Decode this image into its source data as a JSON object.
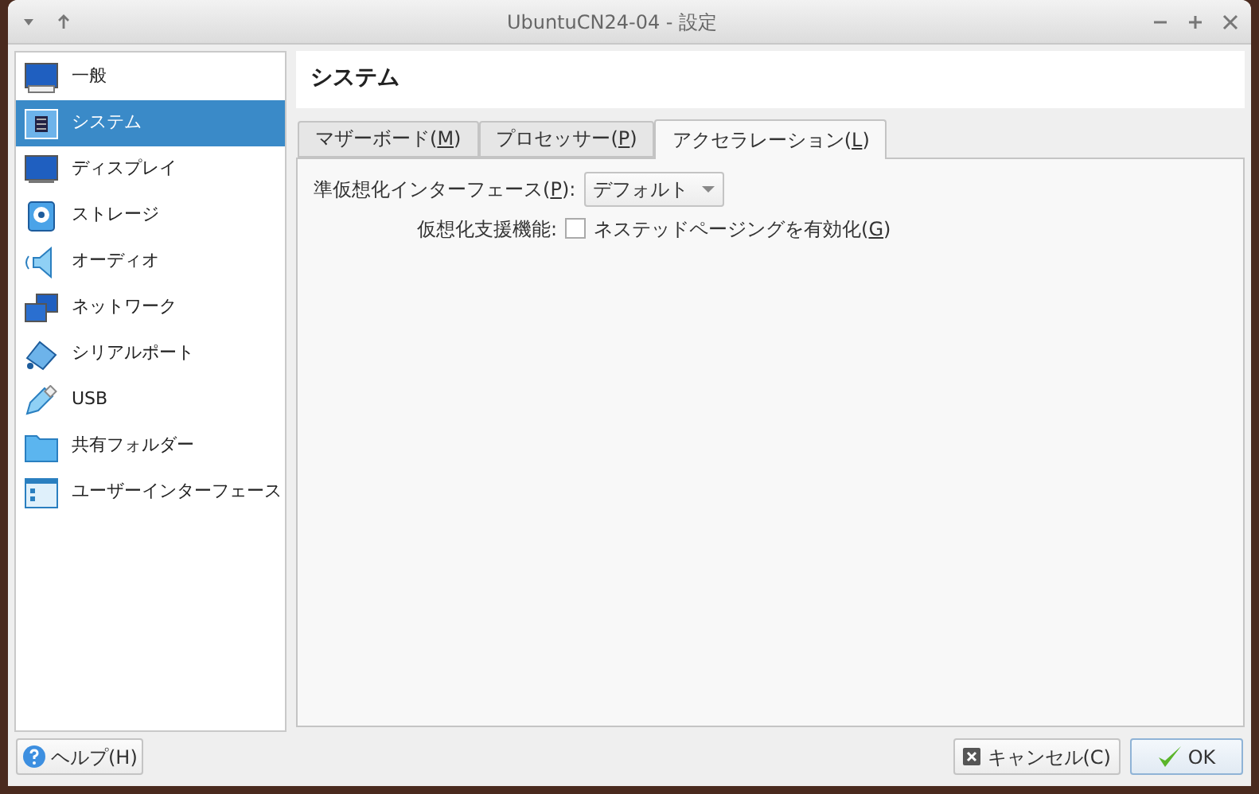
{
  "window": {
    "title": "UbuntuCN24-04 - 設定"
  },
  "sidebar": {
    "items": [
      {
        "label": "一般",
        "kind": "monitor",
        "selected": false
      },
      {
        "label": "システム",
        "kind": "chip",
        "selected": true
      },
      {
        "label": "ディスプレイ",
        "kind": "display",
        "selected": false
      },
      {
        "label": "ストレージ",
        "kind": "disk",
        "selected": false
      },
      {
        "label": "オーディオ",
        "kind": "speaker",
        "selected": false
      },
      {
        "label": "ネットワーク",
        "kind": "network",
        "selected": false
      },
      {
        "label": "シリアルポート",
        "kind": "serial",
        "selected": false
      },
      {
        "label": "USB",
        "kind": "usb",
        "selected": false
      },
      {
        "label": "共有フォルダー",
        "kind": "folder",
        "selected": false
      },
      {
        "label": "ユーザーインターフェース",
        "kind": "ui",
        "selected": false
      }
    ]
  },
  "page_title": "システム",
  "tabs": [
    {
      "label": "マザーボード(M)",
      "selected": false
    },
    {
      "label": "プロセッサー(P)",
      "selected": false
    },
    {
      "label": "アクセラレーション(L)",
      "selected": true
    }
  ],
  "paravirt": {
    "label": "準仮想化インターフェース(P):",
    "value": "デフォルト"
  },
  "hw_virt": {
    "label": "仮想化支援機能:",
    "checkbox": "ネステッドページングを有効化(G)",
    "checked": false
  },
  "buttons": {
    "help": "ヘルプ(H)",
    "cancel": "キャンセル(C)",
    "ok": "OK"
  }
}
